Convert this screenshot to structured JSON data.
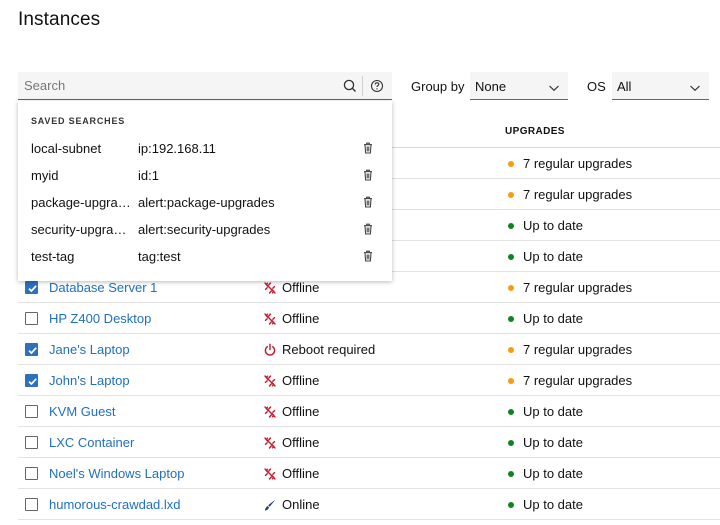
{
  "page": {
    "title": "Instances"
  },
  "toolbar": {
    "search_placeholder": "Search",
    "search_icon": "search-icon",
    "help_icon": "help-icon",
    "group_by_label": "Group by",
    "group_by_value": "None",
    "os_label": "OS",
    "os_value": "All"
  },
  "table": {
    "upgrades_header": "UPGRADES",
    "rows": [
      {
        "name": "",
        "checked": false,
        "status": "",
        "status_icon": "",
        "upgrades": "7 regular upgrades",
        "upgrades_state": "pending"
      },
      {
        "name": "",
        "checked": false,
        "status": "",
        "status_icon": "",
        "upgrades": "7 regular upgrades",
        "upgrades_state": "pending"
      },
      {
        "name": "",
        "checked": false,
        "status": "",
        "status_icon": "",
        "upgrades": "Up to date",
        "upgrades_state": "ok"
      },
      {
        "name": "",
        "checked": false,
        "status": "",
        "status_icon": "",
        "upgrades": "Up to date",
        "upgrades_state": "ok"
      },
      {
        "name": "Database Server 1",
        "checked": true,
        "status": "Offline",
        "status_icon": "offline-icon",
        "upgrades": "7 regular upgrades",
        "upgrades_state": "pending"
      },
      {
        "name": "HP Z400 Desktop",
        "checked": false,
        "status": "Offline",
        "status_icon": "offline-icon",
        "upgrades": "Up to date",
        "upgrades_state": "ok"
      },
      {
        "name": "Jane's Laptop",
        "checked": true,
        "status": "Reboot required",
        "status_icon": "power-icon",
        "upgrades": "7 regular upgrades",
        "upgrades_state": "pending"
      },
      {
        "name": "John's Laptop",
        "checked": true,
        "status": "Offline",
        "status_icon": "offline-icon",
        "upgrades": "7 regular upgrades",
        "upgrades_state": "pending"
      },
      {
        "name": "KVM Guest",
        "checked": false,
        "status": "Offline",
        "status_icon": "offline-icon",
        "upgrades": "Up to date",
        "upgrades_state": "ok"
      },
      {
        "name": "LXC Container",
        "checked": false,
        "status": "Offline",
        "status_icon": "offline-icon",
        "upgrades": "Up to date",
        "upgrades_state": "ok"
      },
      {
        "name": "Noel's Windows Laptop",
        "checked": false,
        "status": "Offline",
        "status_icon": "offline-icon",
        "upgrades": "Up to date",
        "upgrades_state": "ok"
      },
      {
        "name": "humorous-crawdad.lxd",
        "checked": false,
        "status": "Online",
        "status_icon": "online-icon",
        "upgrades": "Up to date",
        "upgrades_state": "ok"
      }
    ]
  },
  "saved_searches": {
    "title": "SAVED SEARCHES",
    "delete_icon": "trash-icon",
    "items": [
      {
        "name": "local-subnet",
        "query": "ip:192.168.11"
      },
      {
        "name": "myid",
        "query": "id:1"
      },
      {
        "name": "package-upgrades",
        "query": "alert:package-upgrades"
      },
      {
        "name": "security-upgrades",
        "query": "alert:security-upgrades"
      },
      {
        "name": "test-tag",
        "query": "tag:test"
      }
    ]
  },
  "colors": {
    "link": "#1f6fc0",
    "checkbox": "#2e6fbe",
    "pending": "#f99b11",
    "ok": "#0e8420",
    "offline": "#c7162b",
    "reboot": "#c7162b",
    "online": "#1f3c88"
  }
}
